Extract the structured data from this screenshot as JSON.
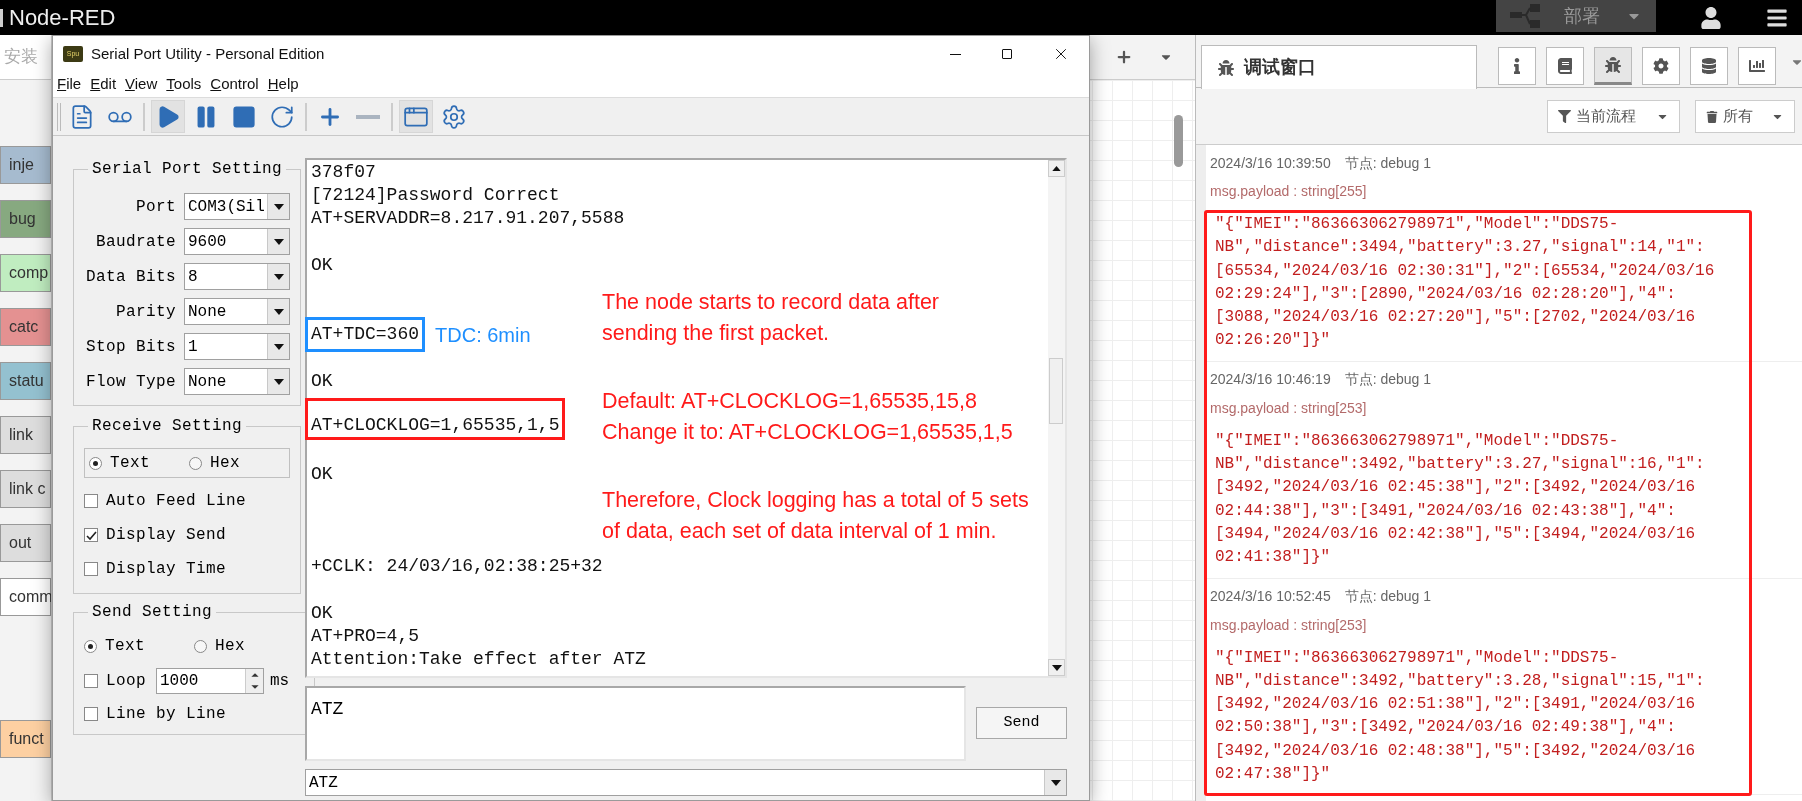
{
  "top_bar": {
    "title": "Node-RED",
    "deploy_label": "部署"
  },
  "palette": {
    "search_hint": "安装",
    "categories": [
      {
        "nodes": [
          {
            "label": "inje",
            "color": "#a6bbcf"
          },
          {
            "label": "bug",
            "color": "#87a980"
          },
          {
            "label": "comp",
            "color": "#c0edc0"
          },
          {
            "label": "catc",
            "color": "#e49191"
          },
          {
            "label": "statu",
            "color": "#94c1d0"
          },
          {
            "label": "link",
            "color": "#dddddd"
          },
          {
            "label": "link c",
            "color": "#dddddd"
          },
          {
            "label": "out",
            "color": "#dddddd"
          },
          {
            "label": "comm",
            "color": "#ffffff"
          }
        ]
      },
      {
        "nodes": [
          {
            "label": "funct",
            "color": "#fdd0a2"
          }
        ]
      }
    ]
  },
  "serial_window": {
    "icon_text": "Spu",
    "title": "Serial Port Utility - Personal Edition",
    "menu": [
      "File",
      "Edit",
      "View",
      "Tools",
      "Control",
      "Help"
    ],
    "toolbar": [
      {
        "kind": "new",
        "pressed": false
      },
      {
        "kind": "record",
        "pressed": false
      },
      {
        "kind": "play",
        "pressed": true
      },
      {
        "kind": "pause",
        "pressed": false
      },
      {
        "kind": "stop",
        "pressed": false
      },
      {
        "kind": "refresh",
        "pressed": false
      },
      {
        "kind": "add",
        "pressed": false
      },
      {
        "kind": "remove",
        "pressed": false
      },
      {
        "kind": "layout",
        "pressed": true
      },
      {
        "kind": "settings",
        "pressed": false
      }
    ],
    "port_setting": {
      "title": "Serial Port Setting",
      "fields": [
        {
          "label": "Port",
          "value": "COM3(Sil"
        },
        {
          "label": "Baudrate",
          "value": "9600"
        },
        {
          "label": "Data Bits",
          "value": "8"
        },
        {
          "label": "Parity",
          "value": "None"
        },
        {
          "label": "Stop Bits",
          "value": "1"
        },
        {
          "label": "Flow Type",
          "value": "None"
        }
      ]
    },
    "receive_setting": {
      "title": "Receive Setting",
      "modes": [
        {
          "label": "Text",
          "selected": true
        },
        {
          "label": "Hex",
          "selected": false
        }
      ],
      "options": [
        {
          "label": "Auto Feed Line",
          "checked": false
        },
        {
          "label": "Display Send",
          "checked": true
        },
        {
          "label": "Display Time",
          "checked": false
        }
      ]
    },
    "send_setting": {
      "title": "Send Setting",
      "modes": [
        {
          "label": "Text",
          "selected": true
        },
        {
          "label": "Hex",
          "selected": false
        }
      ],
      "loop": {
        "label": "Loop",
        "checked": false,
        "value": "1000",
        "unit": "ms"
      },
      "line_by_line": {
        "label": "Line by Line",
        "checked": false
      }
    },
    "receive_lines": [
      {
        "kind": "text",
        "text": "378f07"
      },
      {
        "kind": "text",
        "text": "[72124]Password Correct"
      },
      {
        "kind": "text",
        "text": "AT+SERVADDR=8.217.91.207,5588"
      },
      {
        "kind": "blank"
      },
      {
        "kind": "text",
        "text": "OK"
      },
      {
        "kind": "blank"
      },
      {
        "kind": "blank"
      },
      {
        "kind": "boxed",
        "text": "AT+TDC=360",
        "color": "#1e8fff",
        "note": "TDC: 6min"
      },
      {
        "kind": "blank"
      },
      {
        "kind": "text",
        "text": "OK"
      },
      {
        "kind": "blank"
      },
      {
        "kind": "boxed",
        "text": "AT+CLOCKLOG=1,65535,1,5",
        "color": "#ff1a1a"
      },
      {
        "kind": "blank"
      },
      {
        "kind": "text",
        "text": "OK"
      },
      {
        "kind": "blank"
      },
      {
        "kind": "blank"
      },
      {
        "kind": "blank"
      },
      {
        "kind": "text",
        "text": "+CCLK: 24/03/16,02:38:25+32"
      },
      {
        "kind": "blank"
      },
      {
        "kind": "text",
        "text": "OK"
      },
      {
        "kind": "text",
        "text": "AT+PRO=4,5"
      },
      {
        "kind": "text",
        "text": "Attention:Take effect after ATZ"
      }
    ],
    "annotations": [
      {
        "lines": [
          "The node starts to record data after",
          "sending the first packet."
        ]
      },
      {
        "lines": [
          "Default: AT+CLOCKLOG=1,65535,15,8",
          "Change it to: AT+CLOCKLOG=1,65535,1,5"
        ]
      },
      {
        "lines": [
          "Therefore, Clock logging has a total of 5 sets",
          "of data, each set of data interval of 1 min."
        ]
      }
    ],
    "send_text": "ATZ",
    "send_button": "Send",
    "history_value": "ATZ"
  },
  "debug_panel": {
    "tab_label": "调试窗口",
    "sidebar_tabs": [
      {
        "kind": "info",
        "selected": false
      },
      {
        "kind": "help",
        "selected": false
      },
      {
        "kind": "debug",
        "selected": true
      },
      {
        "kind": "config",
        "selected": false
      },
      {
        "kind": "context",
        "selected": false
      },
      {
        "kind": "dashboard",
        "selected": false
      }
    ],
    "filter_label": "当前流程",
    "clear_label": "所有",
    "messages": [
      {
        "time": "2024/3/16 10:39:50",
        "node": "节点: debug 1",
        "type": "msg.payload : string[255]",
        "payload": "\"{\"IMEI\":\"863663062798971\",\"Model\":\"DDS75-NB\",\"distance\":3494,\"battery\":3.27,\"signal\":14,\"1\":[65534,\"2024/03/16 02:30:31\"],\"2\":[65534,\"2024/03/16 02:29:24\"],\"3\":[2890,\"2024/03/16 02:28:20\"],\"4\":[3088,\"2024/03/16 02:27:20\"],\"5\":[2702,\"2024/03/16 02:26:20\"]}\""
      },
      {
        "time": "2024/3/16 10:46:19",
        "node": "节点: debug 1",
        "type": "msg.payload : string[253]",
        "payload": "\"{\"IMEI\":\"863663062798971\",\"Model\":\"DDS75-NB\",\"distance\":3492,\"battery\":3.27,\"signal\":16,\"1\":[3492,\"2024/03/16 02:45:38\"],\"2\":[3492,\"2024/03/16 02:44:38\"],\"3\":[3491,\"2024/03/16 02:43:38\"],\"4\":[3494,\"2024/03/16 02:42:38\"],\"5\":[3494,\"2024/03/16 02:41:38\"]}\""
      },
      {
        "time": "2024/3/16 10:52:45",
        "node": "节点: debug 1",
        "type": "msg.payload : string[253]",
        "payload": "\"{\"IMEI\":\"863663062798971\",\"Model\":\"DDS75-NB\",\"distance\":3492,\"battery\":3.28,\"signal\":15,\"1\":[3492,\"2024/03/16 02:51:38\"],\"2\":[3491,\"2024/03/16 02:50:38\"],\"3\":[3492,\"2024/03/16 02:49:38\"],\"4\":[3492,\"2024/03/16 02:48:38\"],\"5\":[3492,\"2024/03/16 02:47:38\"]}\""
      }
    ]
  }
}
